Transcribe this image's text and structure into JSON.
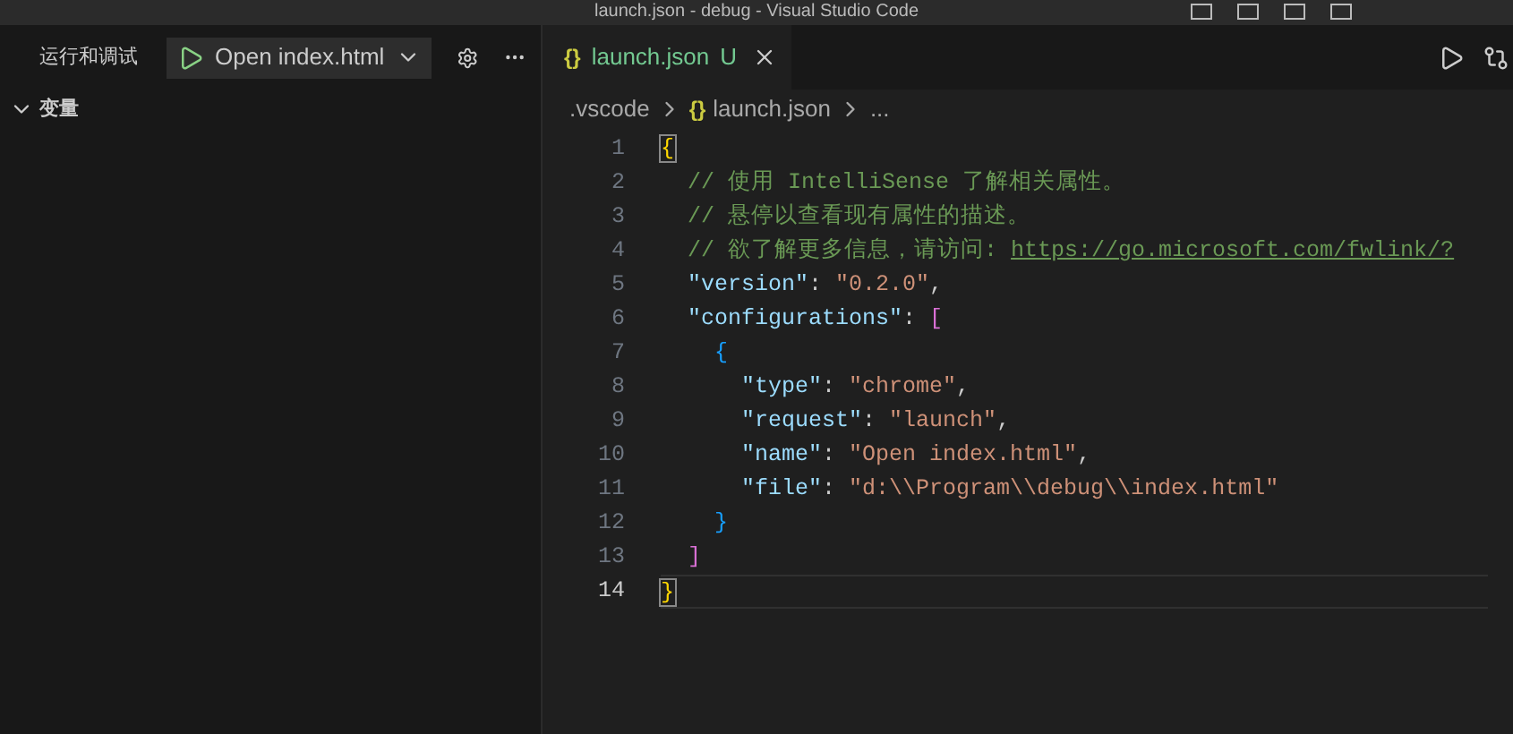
{
  "window": {
    "title": "launch.json - debug - Visual Studio Code"
  },
  "sidebar": {
    "title": "运行和调试",
    "config": {
      "label": "Open index.html"
    },
    "sections": [
      {
        "label": "变量",
        "expanded": true
      }
    ]
  },
  "tabs": [
    {
      "icon": "{}",
      "label": "launch.json",
      "badge": "U",
      "selected": true
    }
  ],
  "breadcrumb": [
    {
      "label": ".vscode",
      "kind": "folder"
    },
    {
      "icon": "{}",
      "label": "launch.json",
      "kind": "json"
    },
    {
      "label": "...",
      "kind": "more"
    }
  ],
  "editor": {
    "lines": [
      {
        "number": "1",
        "current": false,
        "tokens": [
          {
            "text": "{",
            "kind": "brace-matched"
          }
        ]
      },
      {
        "number": "2",
        "current": false,
        "tokens": [
          {
            "text": "  // 使用 IntelliSense 了解相关属性。",
            "kind": "comment"
          }
        ]
      },
      {
        "number": "3",
        "current": false,
        "tokens": [
          {
            "text": "  // 悬停以查看现有属性的描述。",
            "kind": "comment"
          }
        ]
      },
      {
        "number": "4",
        "current": false,
        "tokens": [
          {
            "text": "  // 欲了解更多信息，请访问: ",
            "kind": "comment"
          },
          {
            "text": "https://go.microsoft.com/fwlink/?",
            "kind": "link"
          }
        ]
      },
      {
        "number": "5",
        "current": false,
        "tokens": [
          {
            "text": "  \"version\"",
            "kind": "key"
          },
          {
            "text": ": ",
            "kind": "punct"
          },
          {
            "text": "\"0.2.0\"",
            "kind": "string"
          },
          {
            "text": ",",
            "kind": "punct"
          }
        ]
      },
      {
        "number": "6",
        "current": false,
        "tokens": [
          {
            "text": "  \"configurations\"",
            "kind": "key"
          },
          {
            "text": ": ",
            "kind": "punct"
          },
          {
            "text": "[",
            "kind": "brace2"
          }
        ]
      },
      {
        "number": "7",
        "current": false,
        "tokens": [
          {
            "text": "    {",
            "kind": "brace3"
          }
        ]
      },
      {
        "number": "8",
        "current": false,
        "tokens": [
          {
            "text": "      \"type\"",
            "kind": "key"
          },
          {
            "text": ": ",
            "kind": "punct"
          },
          {
            "text": "\"chrome\"",
            "kind": "string"
          },
          {
            "text": ",",
            "kind": "punct"
          }
        ]
      },
      {
        "number": "9",
        "current": false,
        "tokens": [
          {
            "text": "      \"request\"",
            "kind": "key"
          },
          {
            "text": ": ",
            "kind": "punct"
          },
          {
            "text": "\"launch\"",
            "kind": "string"
          },
          {
            "text": ",",
            "kind": "punct"
          }
        ]
      },
      {
        "number": "10",
        "current": false,
        "tokens": [
          {
            "text": "      \"name\"",
            "kind": "key"
          },
          {
            "text": ": ",
            "kind": "punct"
          },
          {
            "text": "\"Open index.html\"",
            "kind": "string"
          },
          {
            "text": ",",
            "kind": "punct"
          }
        ]
      },
      {
        "number": "11",
        "current": false,
        "tokens": [
          {
            "text": "      \"file\"",
            "kind": "key"
          },
          {
            "text": ": ",
            "kind": "punct"
          },
          {
            "text": "\"d:\\\\Program\\\\debug\\\\index.html\"",
            "kind": "string"
          }
        ]
      },
      {
        "number": "12",
        "current": false,
        "tokens": [
          {
            "text": "    }",
            "kind": "brace3"
          }
        ]
      },
      {
        "number": "13",
        "current": false,
        "tokens": [
          {
            "text": "  ]",
            "kind": "brace2"
          }
        ]
      },
      {
        "number": "14",
        "current": true,
        "tokens": [
          {
            "text": "}",
            "kind": "brace-matched"
          }
        ]
      }
    ]
  }
}
